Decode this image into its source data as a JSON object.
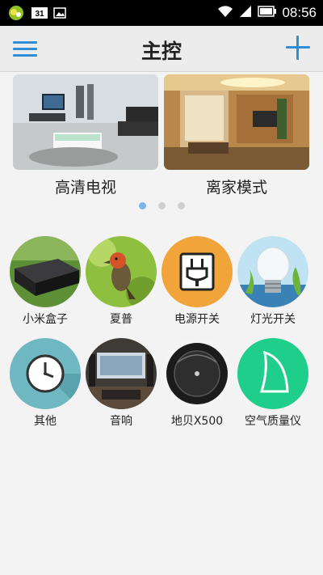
{
  "status_bar": {
    "time": "08:56",
    "notice_badge": "31"
  },
  "header": {
    "title": "主控"
  },
  "carousel": {
    "slides": [
      {
        "label": "高清电视",
        "icon": "living-room-tv-image"
      },
      {
        "label": "离家模式",
        "icon": "home-interior-image"
      }
    ],
    "active_dot": 0,
    "dot_count": 3
  },
  "devices": [
    {
      "label": "小米盒子",
      "icon": "mi-box-icon"
    },
    {
      "label": "夏普",
      "icon": "bird-photo-icon"
    },
    {
      "label": "电源开关",
      "icon": "power-plug-icon"
    },
    {
      "label": "灯光开关",
      "icon": "light-bulb-icon"
    },
    {
      "label": "其他",
      "icon": "clock-icon"
    },
    {
      "label": "音响",
      "icon": "home-theater-icon"
    },
    {
      "label": "地贝X500",
      "icon": "robot-vacuum-icon"
    },
    {
      "label": "空气质量仪",
      "icon": "air-quality-monitor-icon"
    }
  ],
  "colors": {
    "accent": "#2f8fd6",
    "background": "#f3f3f3",
    "plug_orange": "#f0a43a",
    "clock_teal": "#6fb8c2",
    "air_green": "#1fce8a"
  }
}
